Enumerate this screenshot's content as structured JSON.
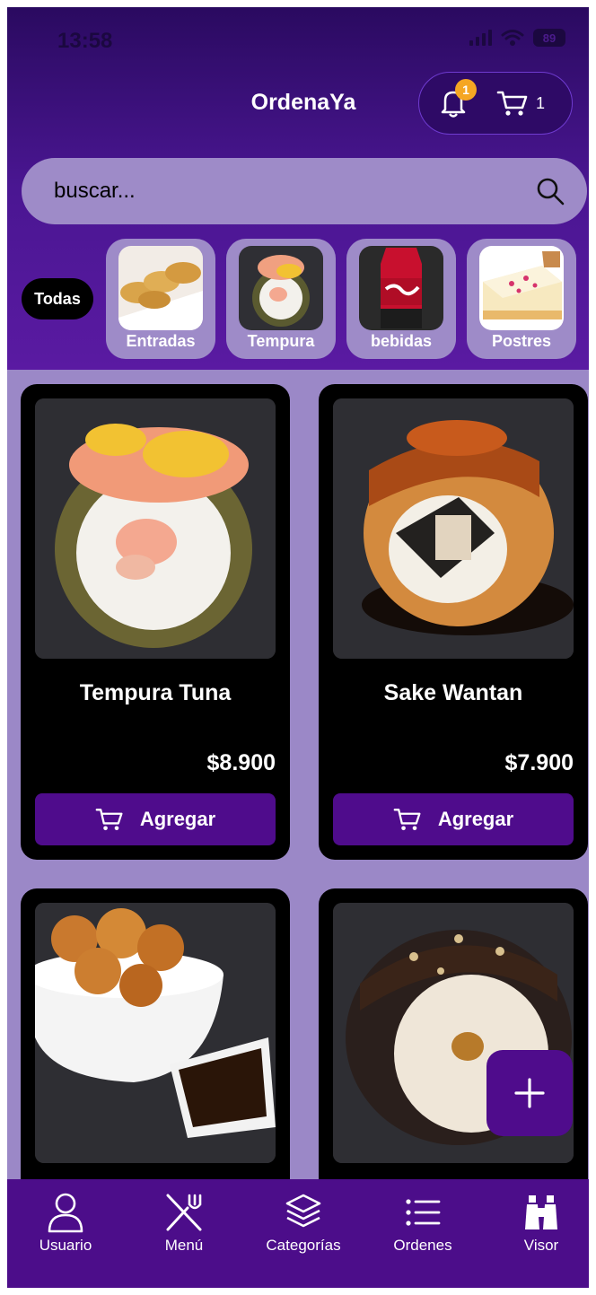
{
  "status": {
    "time": "13:58",
    "battery": "89"
  },
  "header": {
    "title": "OrdenaYa",
    "notifications_count": "1",
    "cart_count": "1"
  },
  "search": {
    "placeholder": "buscar..."
  },
  "categories": {
    "all_label": "Todas",
    "items": [
      {
        "label": "Entradas",
        "icon": "gyoza-photo"
      },
      {
        "label": "Tempura",
        "icon": "tempura-roll-photo"
      },
      {
        "label": "bebidas",
        "icon": "coca-cola-bottle-photo"
      },
      {
        "label": "Postres",
        "icon": "cheesecake-photo"
      }
    ]
  },
  "products": [
    {
      "name": "Tempura Tuna",
      "price": "$8.900",
      "button_label": "Agregar",
      "icon": "tempura-roll-photo"
    },
    {
      "name": "Sake Wantan",
      "price": "$7.900",
      "button_label": "Agregar",
      "icon": "sake-wantan-roll-photo"
    },
    {
      "name": "",
      "price": "",
      "icon": "fried-chicken-rice-bowl-photo"
    },
    {
      "name": "",
      "price": "",
      "icon": "chocolate-dessert-roll-photo"
    }
  ],
  "nav": {
    "items": [
      {
        "label": "Usuario",
        "icon": "user-icon"
      },
      {
        "label": "Menú",
        "icon": "utensils-icon"
      },
      {
        "label": "Categorías",
        "icon": "layers-icon"
      },
      {
        "label": "Ordenes",
        "icon": "list-icon"
      },
      {
        "label": "Visor",
        "icon": "binoculars-icon"
      }
    ]
  },
  "colors": {
    "primary": "#4f0c8c",
    "background": "#9b88c7",
    "card": "#000000",
    "badge": "#f5a623",
    "header_gradient_top": "#2a0a60"
  }
}
